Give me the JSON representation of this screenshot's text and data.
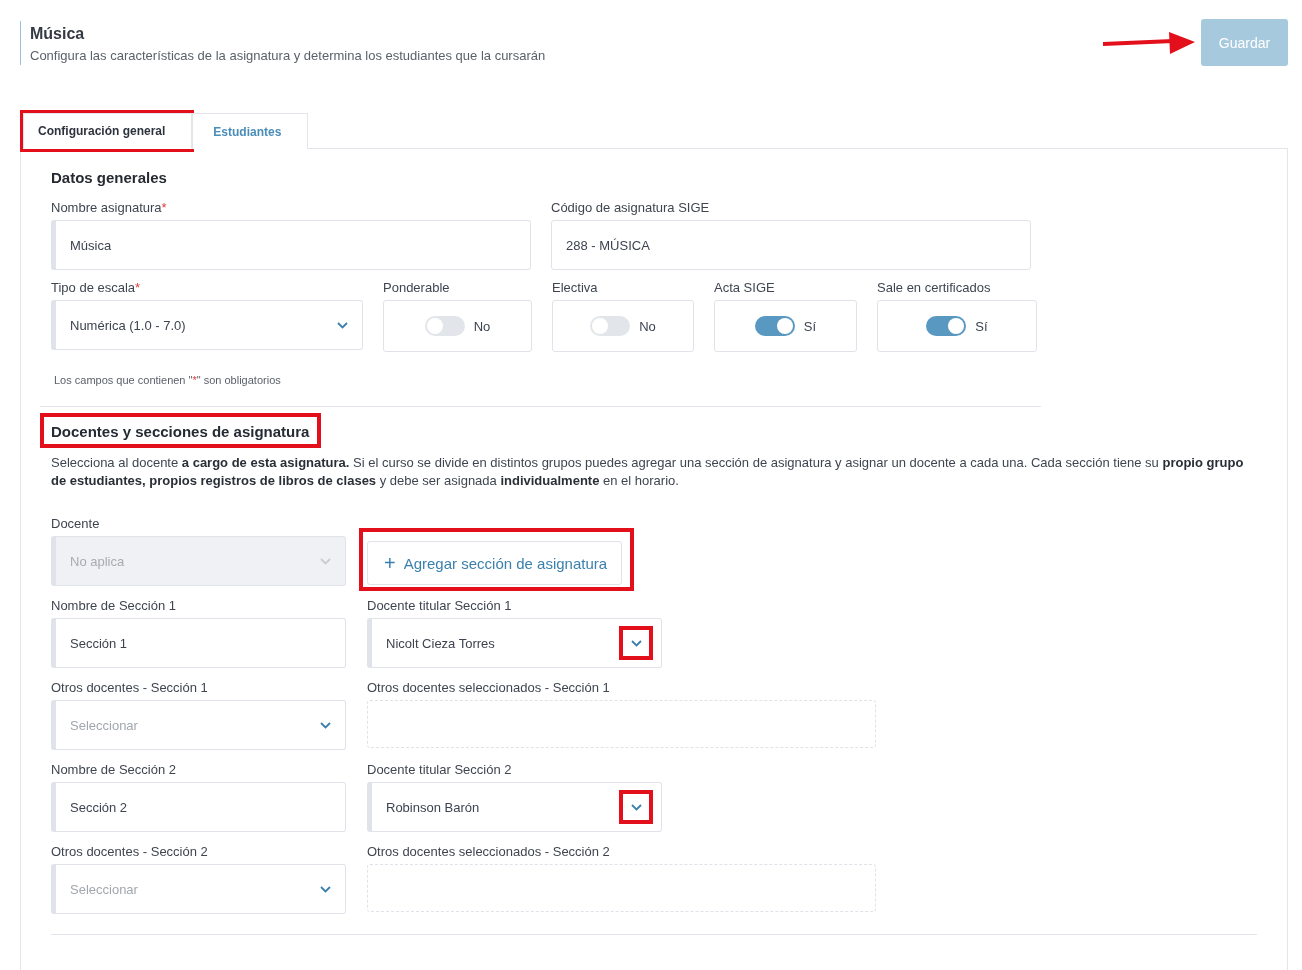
{
  "header": {
    "title": "Música",
    "subtitle": "Configura las características de la asignatura y determina los estudiantes que la cursarán"
  },
  "save_button": {
    "label": "Guardar",
    "disabled": true,
    "highlighted": true
  },
  "tabs": [
    {
      "label": "Configuración general",
      "selected": true,
      "highlighted": true
    },
    {
      "label": "Estudiantes",
      "selected": false,
      "highlighted": false
    }
  ],
  "general": {
    "heading": "Datos generales",
    "name_field": {
      "label": "Nombre asignatura",
      "required_mark": "*",
      "value": "Música"
    },
    "code_field": {
      "label": "Código de asignatura SIGE",
      "value": "288 - MÚSICA"
    },
    "scale_field": {
      "label": "Tipo de escala",
      "required_mark": "*",
      "value": "Numérica (1.0 - 7.0)"
    },
    "toggles": [
      {
        "label": "Ponderable",
        "on": false,
        "text": "No"
      },
      {
        "label": "Electiva",
        "on": false,
        "text": "No"
      },
      {
        "label": "Acta SIGE",
        "on": true,
        "text": "Sí"
      },
      {
        "label": "Sale en certificados",
        "on": true,
        "text": "Sí"
      }
    ],
    "note": {
      "before": "Los campos que contienen \"",
      "mark": "*",
      "after": "\" son obligatorios"
    }
  },
  "teachers": {
    "heading": "Docentes y secciones de asignatura",
    "highlighted": true,
    "description": "Selecciona al docente **a cargo de esta asignatura.** Si el curso se divide en distintos grupos puedes agregar una sección de asignatura y asignar un docente a cada una. Cada sección tiene su **propio grupo de estudiantes, propios registros de libros de clases** y debe ser asignada **individualmente** en el horario.",
    "teacher_field": {
      "label": "Docente",
      "value": "No aplica",
      "disabled": true
    },
    "add_button": {
      "icon": "+",
      "label": "Agregar sección de asignatura",
      "highlighted": true
    },
    "sections": [
      {
        "name_label": "Nombre de Sección 1",
        "name_value": "Sección 1",
        "titular_label": "Docente titular Sección 1",
        "titular_value": "Nicolt Cieza Torres",
        "titular_highlighted": true,
        "others_label": "Otros docentes - Sección 1",
        "others_placeholder": "Seleccionar",
        "selected_label": "Otros docentes seleccionados - Sección 1"
      },
      {
        "name_label": "Nombre de Sección 2",
        "name_value": "Sección 2",
        "titular_label": "Docente titular Sección 2",
        "titular_value": "Robinson Barón",
        "titular_highlighted": true,
        "others_label": "Otros docentes - Sección 2",
        "others_placeholder": "Seleccionar",
        "selected_label": "Otros docentes seleccionados - Sección 2"
      }
    ]
  }
}
